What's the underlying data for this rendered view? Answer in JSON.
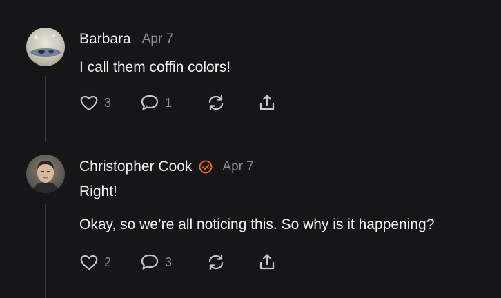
{
  "comments": [
    {
      "author": "Barbara",
      "date": "Apr 7",
      "verified": false,
      "lines": [
        "I call them coffin colors!"
      ],
      "likes": "3",
      "replies": "1"
    },
    {
      "author": "Christopher Cook",
      "date": "Apr 7",
      "verified": true,
      "lines": [
        "Right!",
        "Okay, so we’re all noticing this. So why is it happening?"
      ],
      "likes": "2",
      "replies": "3"
    }
  ],
  "colors": {
    "background": "#161618",
    "text": "#f2f2f2",
    "muted": "#8e8e93",
    "verified_accent": "#ff6719",
    "thread_line": "#3a3a3c"
  },
  "icons": {
    "like": "heart-icon",
    "reply": "speech-bubble-icon",
    "restack": "restack-arrows-icon",
    "share": "share-upload-icon",
    "verified": "verified-check-badge-icon"
  }
}
